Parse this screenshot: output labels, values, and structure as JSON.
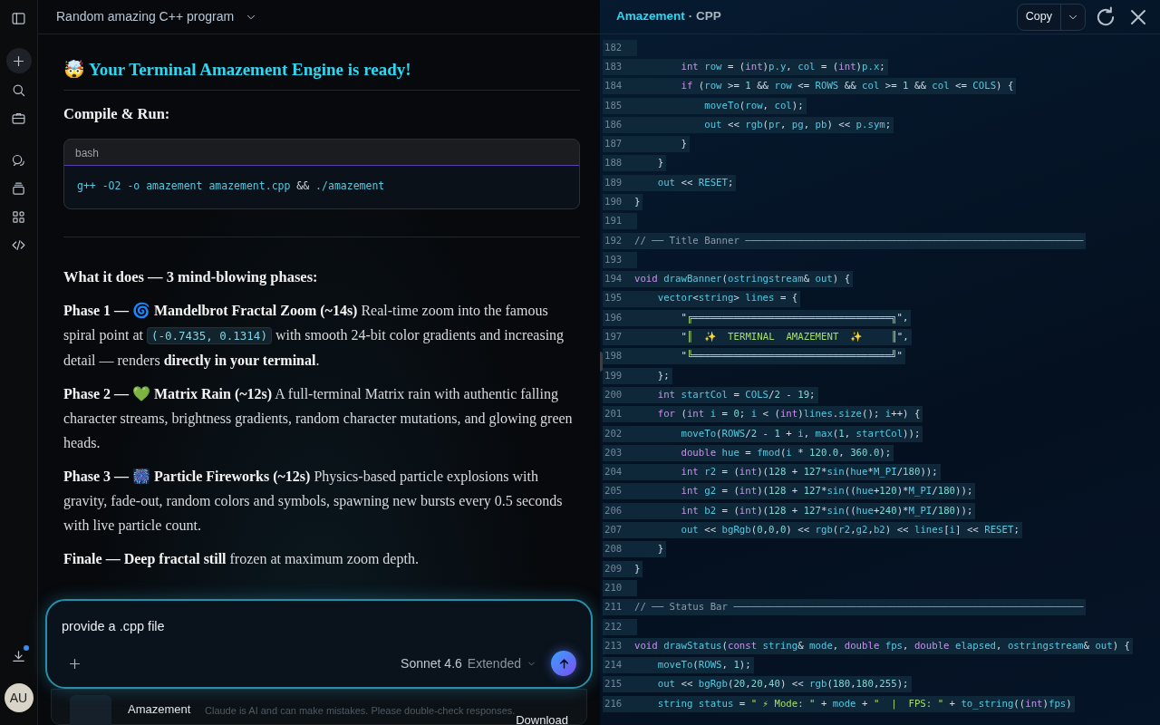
{
  "chat": {
    "title": "Random amazing C++ program",
    "heading": "🤯 Your Terminal Amazement Engine is ready!",
    "subheading": "Compile & Run:",
    "code_block": {
      "language": "bash",
      "tokens": [
        {
          "kind": "i",
          "text": "g++ -O2 -o amazement amazement.cpp"
        },
        {
          "kind": "p",
          "text": " && "
        },
        {
          "kind": "i",
          "text": "./amazement"
        }
      ]
    },
    "phases_title": "What it does — 3 mind-blowing phases:",
    "paragraphs": [
      {
        "segments": [
          {
            "kind": "b",
            "text": "Phase 1 — 🌀 Mandelbrot Fractal Zoom (~14s)"
          },
          {
            "kind": "t",
            "text": " Real-time zoom into the famous spiral point at "
          },
          {
            "kind": "c",
            "text": "(-0.7435, 0.1314)"
          },
          {
            "kind": "t",
            "text": " with smooth 24-bit color gradients and increasing detail — renders "
          },
          {
            "kind": "b",
            "text": "directly in your terminal"
          },
          {
            "kind": "t",
            "text": "."
          }
        ]
      },
      {
        "segments": [
          {
            "kind": "b",
            "text": "Phase 2 — 💚 Matrix Rain (~12s)"
          },
          {
            "kind": "t",
            "text": " A full-terminal Matrix rain with authentic falling character streams, brightness gradients, random character mutations, and glowing green heads."
          }
        ]
      },
      {
        "segments": [
          {
            "kind": "b",
            "text": "Phase 3 — 🎆 Particle Fireworks (~12s)"
          },
          {
            "kind": "t",
            "text": " Physics-based particle explosions with gravity, fade-out, random colors and symbols, spawning new bursts every 0.5 seconds with live particle count."
          }
        ]
      },
      {
        "segments": [
          {
            "kind": "b",
            "text": "Finale — Deep fractal still"
          },
          {
            "kind": "t",
            "text": " frozen at maximum zoom depth."
          }
        ]
      }
    ]
  },
  "composer": {
    "value": "provide a .cpp file",
    "model": "Sonnet 4.6",
    "mode": "Extended"
  },
  "artifact_card": {
    "title": "Amazement",
    "action": "Download"
  },
  "disclaimer": "Claude is AI and can make mistakes. Please double-check responses.",
  "user_avatar": {
    "initials": "AU"
  },
  "code_panel": {
    "title": "Amazement",
    "type": "· CPP",
    "copy_label": "Copy",
    "lines": [
      {
        "number": "182"
      },
      {
        "number": "183",
        "tokens": [
          {
            "kind": "k",
            "text": "        int"
          },
          {
            "kind": "i",
            "text": " row"
          },
          {
            "kind": "p",
            "text": " = ("
          },
          {
            "kind": "k",
            "text": "int"
          },
          {
            "kind": "p",
            "text": ")"
          },
          {
            "kind": "i",
            "text": "p.y"
          },
          {
            "kind": "p",
            "text": ", "
          },
          {
            "kind": "i",
            "text": "col"
          },
          {
            "kind": "p",
            "text": " = ("
          },
          {
            "kind": "k",
            "text": "int"
          },
          {
            "kind": "p",
            "text": ")"
          },
          {
            "kind": "i",
            "text": "p.x"
          },
          {
            "kind": "p",
            "text": ";"
          }
        ]
      },
      {
        "number": "184",
        "tokens": [
          {
            "kind": "k",
            "text": "        if"
          },
          {
            "kind": "p",
            "text": " ("
          },
          {
            "kind": "i",
            "text": "row"
          },
          {
            "kind": "p",
            "text": " >= "
          },
          {
            "kind": "n",
            "text": "1"
          },
          {
            "kind": "p",
            "text": " && "
          },
          {
            "kind": "i",
            "text": "row"
          },
          {
            "kind": "p",
            "text": " <= "
          },
          {
            "kind": "i",
            "text": "ROWS"
          },
          {
            "kind": "p",
            "text": " && "
          },
          {
            "kind": "i",
            "text": "col"
          },
          {
            "kind": "p",
            "text": " >= "
          },
          {
            "kind": "n",
            "text": "1"
          },
          {
            "kind": "p",
            "text": " && "
          },
          {
            "kind": "i",
            "text": "col"
          },
          {
            "kind": "p",
            "text": " <= "
          },
          {
            "kind": "i",
            "text": "COLS"
          },
          {
            "kind": "p",
            "text": ") {"
          }
        ]
      },
      {
        "number": "185",
        "tokens": [
          {
            "kind": "i",
            "text": "            moveTo"
          },
          {
            "kind": "p",
            "text": "("
          },
          {
            "kind": "i",
            "text": "row"
          },
          {
            "kind": "p",
            "text": ", "
          },
          {
            "kind": "i",
            "text": "col"
          },
          {
            "kind": "p",
            "text": ");"
          }
        ]
      },
      {
        "number": "186",
        "tokens": [
          {
            "kind": "i",
            "text": "            out"
          },
          {
            "kind": "p",
            "text": " << "
          },
          {
            "kind": "i",
            "text": "rgb"
          },
          {
            "kind": "p",
            "text": "("
          },
          {
            "kind": "i",
            "text": "pr"
          },
          {
            "kind": "p",
            "text": ", "
          },
          {
            "kind": "i",
            "text": "pg"
          },
          {
            "kind": "p",
            "text": ", "
          },
          {
            "kind": "i",
            "text": "pb"
          },
          {
            "kind": "p",
            "text": ") << "
          },
          {
            "kind": "i",
            "text": "p.sym"
          },
          {
            "kind": "p",
            "text": ";"
          }
        ]
      },
      {
        "number": "187",
        "tokens": [
          {
            "kind": "p",
            "text": "        }"
          }
        ]
      },
      {
        "number": "188",
        "tokens": [
          {
            "kind": "p",
            "text": "    }"
          }
        ]
      },
      {
        "number": "189",
        "tokens": [
          {
            "kind": "i",
            "text": "    out"
          },
          {
            "kind": "p",
            "text": " << "
          },
          {
            "kind": "i",
            "text": "RESET"
          },
          {
            "kind": "p",
            "text": ";"
          }
        ]
      },
      {
        "number": "190",
        "tokens": [
          {
            "kind": "p",
            "text": "}"
          }
        ]
      },
      {
        "number": "191"
      },
      {
        "number": "192",
        "tokens": [
          {
            "kind": "c",
            "text": "// ── Title Banner ──────────────────────────────────────────────────────────"
          }
        ]
      },
      {
        "number": "193"
      },
      {
        "number": "194",
        "tokens": [
          {
            "kind": "k",
            "text": "void"
          },
          {
            "kind": "i",
            "text": " drawBanner"
          },
          {
            "kind": "p",
            "text": "("
          },
          {
            "kind": "i",
            "text": "ostringstream"
          },
          {
            "kind": "p",
            "text": "& "
          },
          {
            "kind": "i",
            "text": "out"
          },
          {
            "kind": "p",
            "text": ") {"
          }
        ]
      },
      {
        "number": "195",
        "tokens": [
          {
            "kind": "i",
            "text": "    vector"
          },
          {
            "kind": "p",
            "text": "<"
          },
          {
            "kind": "i",
            "text": "string"
          },
          {
            "kind": "p",
            "text": "> "
          },
          {
            "kind": "i",
            "text": "lines"
          },
          {
            "kind": "p",
            "text": " = {"
          }
        ]
      },
      {
        "number": "196",
        "tokens": [
          {
            "kind": "p",
            "text": "        \""
          },
          {
            "kind": "s",
            "text": "╔══════════════════════════════════╗"
          },
          {
            "kind": "p",
            "text": "\","
          }
        ]
      },
      {
        "number": "197",
        "tokens": [
          {
            "kind": "p",
            "text": "        \""
          },
          {
            "kind": "s",
            "text": "║  ✨  TERMINAL  AMAZEMENT  ✨     ║"
          },
          {
            "kind": "p",
            "text": "\","
          }
        ]
      },
      {
        "number": "198",
        "tokens": [
          {
            "kind": "p",
            "text": "        \""
          },
          {
            "kind": "s",
            "text": "╚══════════════════════════════════╝"
          },
          {
            "kind": "p",
            "text": "\""
          }
        ]
      },
      {
        "number": "199",
        "tokens": [
          {
            "kind": "p",
            "text": "    };"
          }
        ]
      },
      {
        "number": "200",
        "tokens": [
          {
            "kind": "k",
            "text": "    int"
          },
          {
            "kind": "i",
            "text": " startCol"
          },
          {
            "kind": "p",
            "text": " = "
          },
          {
            "kind": "i",
            "text": "COLS"
          },
          {
            "kind": "p",
            "text": "/"
          },
          {
            "kind": "n",
            "text": "2"
          },
          {
            "kind": "p",
            "text": " - "
          },
          {
            "kind": "n",
            "text": "19"
          },
          {
            "kind": "p",
            "text": ";"
          }
        ]
      },
      {
        "number": "201",
        "tokens": [
          {
            "kind": "k",
            "text": "    for"
          },
          {
            "kind": "p",
            "text": " ("
          },
          {
            "kind": "k",
            "text": "int"
          },
          {
            "kind": "i",
            "text": " i"
          },
          {
            "kind": "p",
            "text": " = "
          },
          {
            "kind": "n",
            "text": "0"
          },
          {
            "kind": "p",
            "text": "; "
          },
          {
            "kind": "i",
            "text": "i"
          },
          {
            "kind": "p",
            "text": " < ("
          },
          {
            "kind": "k",
            "text": "int"
          },
          {
            "kind": "p",
            "text": ")"
          },
          {
            "kind": "i",
            "text": "lines"
          },
          {
            "kind": "p",
            "text": "."
          },
          {
            "kind": "i",
            "text": "size"
          },
          {
            "kind": "p",
            "text": "(); "
          },
          {
            "kind": "i",
            "text": "i"
          },
          {
            "kind": "p",
            "text": "++) {"
          }
        ]
      },
      {
        "number": "202",
        "tokens": [
          {
            "kind": "i",
            "text": "        moveTo"
          },
          {
            "kind": "p",
            "text": "("
          },
          {
            "kind": "i",
            "text": "ROWS"
          },
          {
            "kind": "p",
            "text": "/"
          },
          {
            "kind": "n",
            "text": "2"
          },
          {
            "kind": "p",
            "text": " - "
          },
          {
            "kind": "n",
            "text": "1"
          },
          {
            "kind": "p",
            "text": " + "
          },
          {
            "kind": "i",
            "text": "i"
          },
          {
            "kind": "p",
            "text": ", "
          },
          {
            "kind": "i",
            "text": "max"
          },
          {
            "kind": "p",
            "text": "("
          },
          {
            "kind": "n",
            "text": "1"
          },
          {
            "kind": "p",
            "text": ", "
          },
          {
            "kind": "i",
            "text": "startCol"
          },
          {
            "kind": "p",
            "text": "));"
          }
        ]
      },
      {
        "number": "203",
        "tokens": [
          {
            "kind": "k",
            "text": "        double"
          },
          {
            "kind": "i",
            "text": " hue"
          },
          {
            "kind": "p",
            "text": " = "
          },
          {
            "kind": "i",
            "text": "fmod"
          },
          {
            "kind": "p",
            "text": "("
          },
          {
            "kind": "i",
            "text": "i"
          },
          {
            "kind": "p",
            "text": " * "
          },
          {
            "kind": "n",
            "text": "120.0"
          },
          {
            "kind": "p",
            "text": ", "
          },
          {
            "kind": "n",
            "text": "360.0"
          },
          {
            "kind": "p",
            "text": ");"
          }
        ]
      },
      {
        "number": "204",
        "tokens": [
          {
            "kind": "k",
            "text": "        int"
          },
          {
            "kind": "i",
            "text": " r2"
          },
          {
            "kind": "p",
            "text": " = ("
          },
          {
            "kind": "k",
            "text": "int"
          },
          {
            "kind": "p",
            "text": ")("
          },
          {
            "kind": "n",
            "text": "128"
          },
          {
            "kind": "p",
            "text": " + "
          },
          {
            "kind": "n",
            "text": "127"
          },
          {
            "kind": "p",
            "text": "*"
          },
          {
            "kind": "i",
            "text": "sin"
          },
          {
            "kind": "p",
            "text": "("
          },
          {
            "kind": "i",
            "text": "hue"
          },
          {
            "kind": "p",
            "text": "*"
          },
          {
            "kind": "i",
            "text": "M_PI"
          },
          {
            "kind": "p",
            "text": "/"
          },
          {
            "kind": "n",
            "text": "180"
          },
          {
            "kind": "p",
            "text": "));"
          }
        ]
      },
      {
        "number": "205",
        "tokens": [
          {
            "kind": "k",
            "text": "        int"
          },
          {
            "kind": "i",
            "text": " g2"
          },
          {
            "kind": "p",
            "text": " = ("
          },
          {
            "kind": "k",
            "text": "int"
          },
          {
            "kind": "p",
            "text": ")("
          },
          {
            "kind": "n",
            "text": "128"
          },
          {
            "kind": "p",
            "text": " + "
          },
          {
            "kind": "n",
            "text": "127"
          },
          {
            "kind": "p",
            "text": "*"
          },
          {
            "kind": "i",
            "text": "sin"
          },
          {
            "kind": "p",
            "text": "(("
          },
          {
            "kind": "i",
            "text": "hue"
          },
          {
            "kind": "p",
            "text": "+"
          },
          {
            "kind": "n",
            "text": "120"
          },
          {
            "kind": "p",
            "text": ")*"
          },
          {
            "kind": "i",
            "text": "M_PI"
          },
          {
            "kind": "p",
            "text": "/"
          },
          {
            "kind": "n",
            "text": "180"
          },
          {
            "kind": "p",
            "text": "));"
          }
        ]
      },
      {
        "number": "206",
        "tokens": [
          {
            "kind": "k",
            "text": "        int"
          },
          {
            "kind": "i",
            "text": " b2"
          },
          {
            "kind": "p",
            "text": " = ("
          },
          {
            "kind": "k",
            "text": "int"
          },
          {
            "kind": "p",
            "text": ")("
          },
          {
            "kind": "n",
            "text": "128"
          },
          {
            "kind": "p",
            "text": " + "
          },
          {
            "kind": "n",
            "text": "127"
          },
          {
            "kind": "p",
            "text": "*"
          },
          {
            "kind": "i",
            "text": "sin"
          },
          {
            "kind": "p",
            "text": "(("
          },
          {
            "kind": "i",
            "text": "hue"
          },
          {
            "kind": "p",
            "text": "+"
          },
          {
            "kind": "n",
            "text": "240"
          },
          {
            "kind": "p",
            "text": ")*"
          },
          {
            "kind": "i",
            "text": "M_PI"
          },
          {
            "kind": "p",
            "text": "/"
          },
          {
            "kind": "n",
            "text": "180"
          },
          {
            "kind": "p",
            "text": "));"
          }
        ]
      },
      {
        "number": "207",
        "tokens": [
          {
            "kind": "i",
            "text": "        out"
          },
          {
            "kind": "p",
            "text": " << "
          },
          {
            "kind": "i",
            "text": "bgRgb"
          },
          {
            "kind": "p",
            "text": "("
          },
          {
            "kind": "n",
            "text": "0"
          },
          {
            "kind": "p",
            "text": ","
          },
          {
            "kind": "n",
            "text": "0"
          },
          {
            "kind": "p",
            "text": ","
          },
          {
            "kind": "n",
            "text": "0"
          },
          {
            "kind": "p",
            "text": ") << "
          },
          {
            "kind": "i",
            "text": "rgb"
          },
          {
            "kind": "p",
            "text": "("
          },
          {
            "kind": "i",
            "text": "r2"
          },
          {
            "kind": "p",
            "text": ","
          },
          {
            "kind": "i",
            "text": "g2"
          },
          {
            "kind": "p",
            "text": ","
          },
          {
            "kind": "i",
            "text": "b2"
          },
          {
            "kind": "p",
            "text": ") << "
          },
          {
            "kind": "i",
            "text": "lines"
          },
          {
            "kind": "p",
            "text": "["
          },
          {
            "kind": "i",
            "text": "i"
          },
          {
            "kind": "p",
            "text": "] << "
          },
          {
            "kind": "i",
            "text": "RESET"
          },
          {
            "kind": "p",
            "text": ";"
          }
        ]
      },
      {
        "number": "208",
        "tokens": [
          {
            "kind": "p",
            "text": "    }"
          }
        ]
      },
      {
        "number": "209",
        "tokens": [
          {
            "kind": "p",
            "text": "}"
          }
        ]
      },
      {
        "number": "210"
      },
      {
        "number": "211",
        "tokens": [
          {
            "kind": "c",
            "text": "// ── Status Bar ────────────────────────────────────────────────────────────"
          }
        ]
      },
      {
        "number": "212"
      },
      {
        "number": "213",
        "tokens": [
          {
            "kind": "k",
            "text": "void"
          },
          {
            "kind": "i",
            "text": " drawStatus"
          },
          {
            "kind": "p",
            "text": "("
          },
          {
            "kind": "k",
            "text": "const"
          },
          {
            "kind": "i",
            "text": " string"
          },
          {
            "kind": "p",
            "text": "& "
          },
          {
            "kind": "i",
            "text": "mode"
          },
          {
            "kind": "p",
            "text": ", "
          },
          {
            "kind": "k",
            "text": "double"
          },
          {
            "kind": "i",
            "text": " fps"
          },
          {
            "kind": "p",
            "text": ", "
          },
          {
            "kind": "k",
            "text": "double"
          },
          {
            "kind": "i",
            "text": " elapsed"
          },
          {
            "kind": "p",
            "text": ", "
          },
          {
            "kind": "i",
            "text": "ostringstream"
          },
          {
            "kind": "p",
            "text": "& "
          },
          {
            "kind": "i",
            "text": "out"
          },
          {
            "kind": "p",
            "text": ") {"
          }
        ]
      },
      {
        "number": "214",
        "tokens": [
          {
            "kind": "i",
            "text": "    moveTo"
          },
          {
            "kind": "p",
            "text": "("
          },
          {
            "kind": "i",
            "text": "ROWS"
          },
          {
            "kind": "p",
            "text": ", "
          },
          {
            "kind": "n",
            "text": "1"
          },
          {
            "kind": "p",
            "text": ");"
          }
        ]
      },
      {
        "number": "215",
        "tokens": [
          {
            "kind": "i",
            "text": "    out"
          },
          {
            "kind": "p",
            "text": " << "
          },
          {
            "kind": "i",
            "text": "bgRgb"
          },
          {
            "kind": "p",
            "text": "("
          },
          {
            "kind": "n",
            "text": "20"
          },
          {
            "kind": "p",
            "text": ","
          },
          {
            "kind": "n",
            "text": "20"
          },
          {
            "kind": "p",
            "text": ","
          },
          {
            "kind": "n",
            "text": "40"
          },
          {
            "kind": "p",
            "text": ") << "
          },
          {
            "kind": "i",
            "text": "rgb"
          },
          {
            "kind": "p",
            "text": "("
          },
          {
            "kind": "n",
            "text": "180"
          },
          {
            "kind": "p",
            "text": ","
          },
          {
            "kind": "n",
            "text": "180"
          },
          {
            "kind": "p",
            "text": ","
          },
          {
            "kind": "n",
            "text": "255"
          },
          {
            "kind": "p",
            "text": ");"
          }
        ]
      },
      {
        "number": "216",
        "tokens": [
          {
            "kind": "i",
            "text": "    string"
          },
          {
            "kind": "i",
            "text": " status"
          },
          {
            "kind": "p",
            "text": " = "
          },
          {
            "kind": "s",
            "text": "\" ⚡ Mode: \""
          },
          {
            "kind": "p",
            "text": " + "
          },
          {
            "kind": "i",
            "text": "mode"
          },
          {
            "kind": "p",
            "text": " + "
          },
          {
            "kind": "s",
            "text": "\"  |  FPS: \""
          },
          {
            "kind": "p",
            "text": " + "
          },
          {
            "kind": "i",
            "text": "to_string"
          },
          {
            "kind": "p",
            "text": "(("
          },
          {
            "kind": "k",
            "text": "int"
          },
          {
            "kind": "p",
            "text": ")"
          },
          {
            "kind": "i",
            "text": "fps"
          },
          {
            "kind": "p",
            "text": ")"
          }
        ]
      }
    ]
  }
}
